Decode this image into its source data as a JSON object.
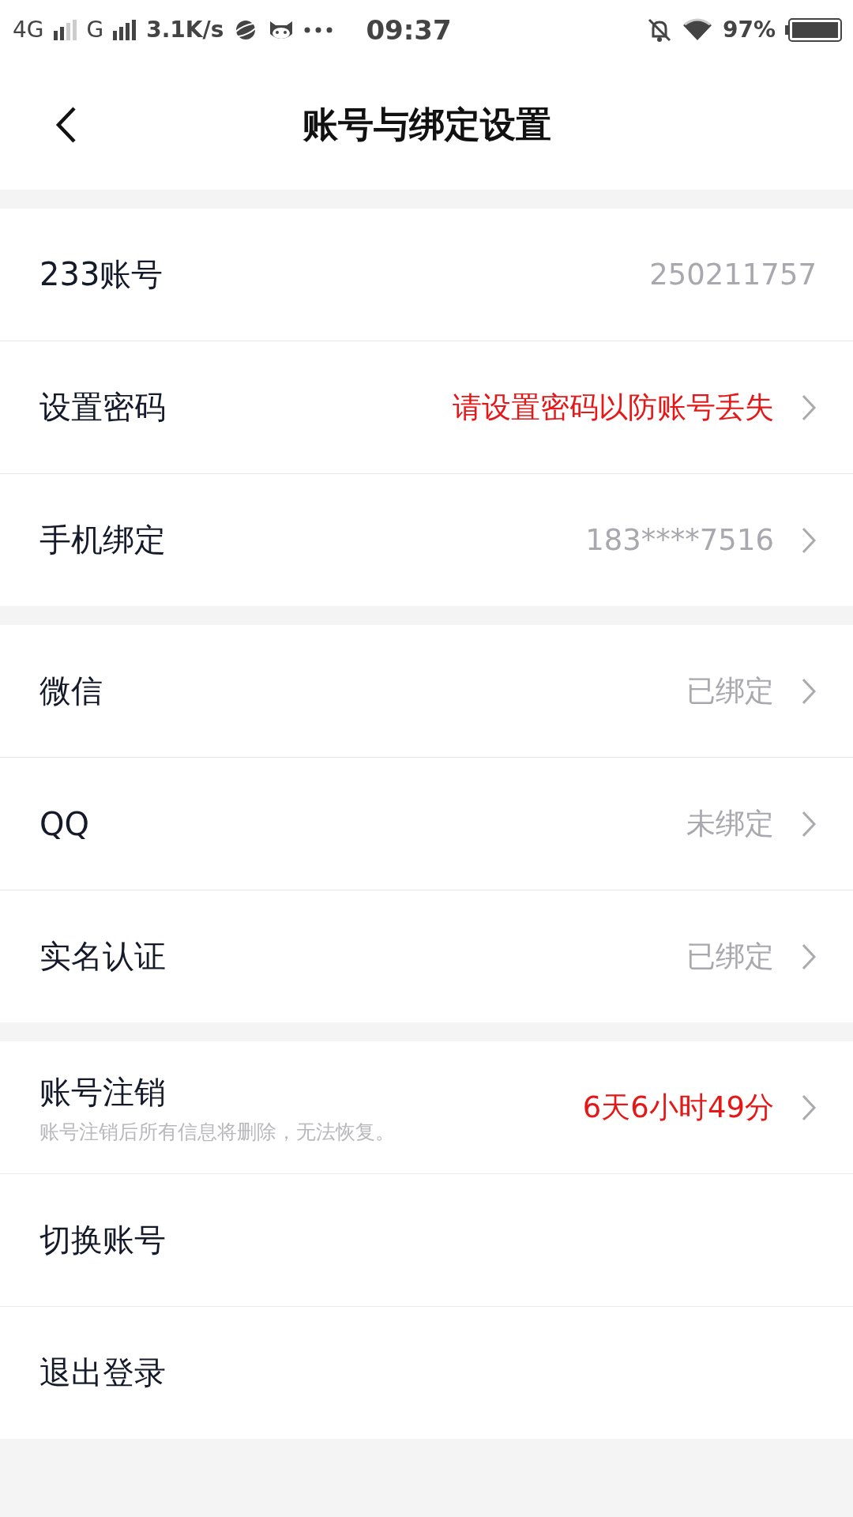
{
  "status_bar": {
    "network_1": "4G",
    "network_2": "G",
    "speed": "3.1K/s",
    "time": "09:37",
    "battery": "97%"
  },
  "header": {
    "title": "账号与绑定设置"
  },
  "groups": [
    {
      "rows": [
        {
          "label": "233账号",
          "value": "250211757",
          "emphasis": false,
          "arrow": false
        },
        {
          "label": "设置密码",
          "value": "请设置密码以防账号丢失",
          "emphasis": true,
          "arrow": true
        },
        {
          "label": "手机绑定",
          "value": "183****7516",
          "emphasis": false,
          "arrow": true
        }
      ]
    },
    {
      "rows": [
        {
          "label": "微信",
          "value": "已绑定",
          "emphasis": false,
          "arrow": true
        },
        {
          "label": "QQ",
          "value": "未绑定",
          "emphasis": false,
          "arrow": true
        },
        {
          "label": "实名认证",
          "value": "已绑定",
          "emphasis": false,
          "arrow": true
        }
      ]
    },
    {
      "rows": [
        {
          "label": "账号注销",
          "subtitle": "账号注销后所有信息将删除，无法恢复。",
          "value": "6天6小时49分",
          "emphasis": true,
          "arrow": true
        },
        {
          "label": "切换账号",
          "arrow": false
        },
        {
          "label": "退出登录",
          "arrow": false
        }
      ]
    }
  ]
}
